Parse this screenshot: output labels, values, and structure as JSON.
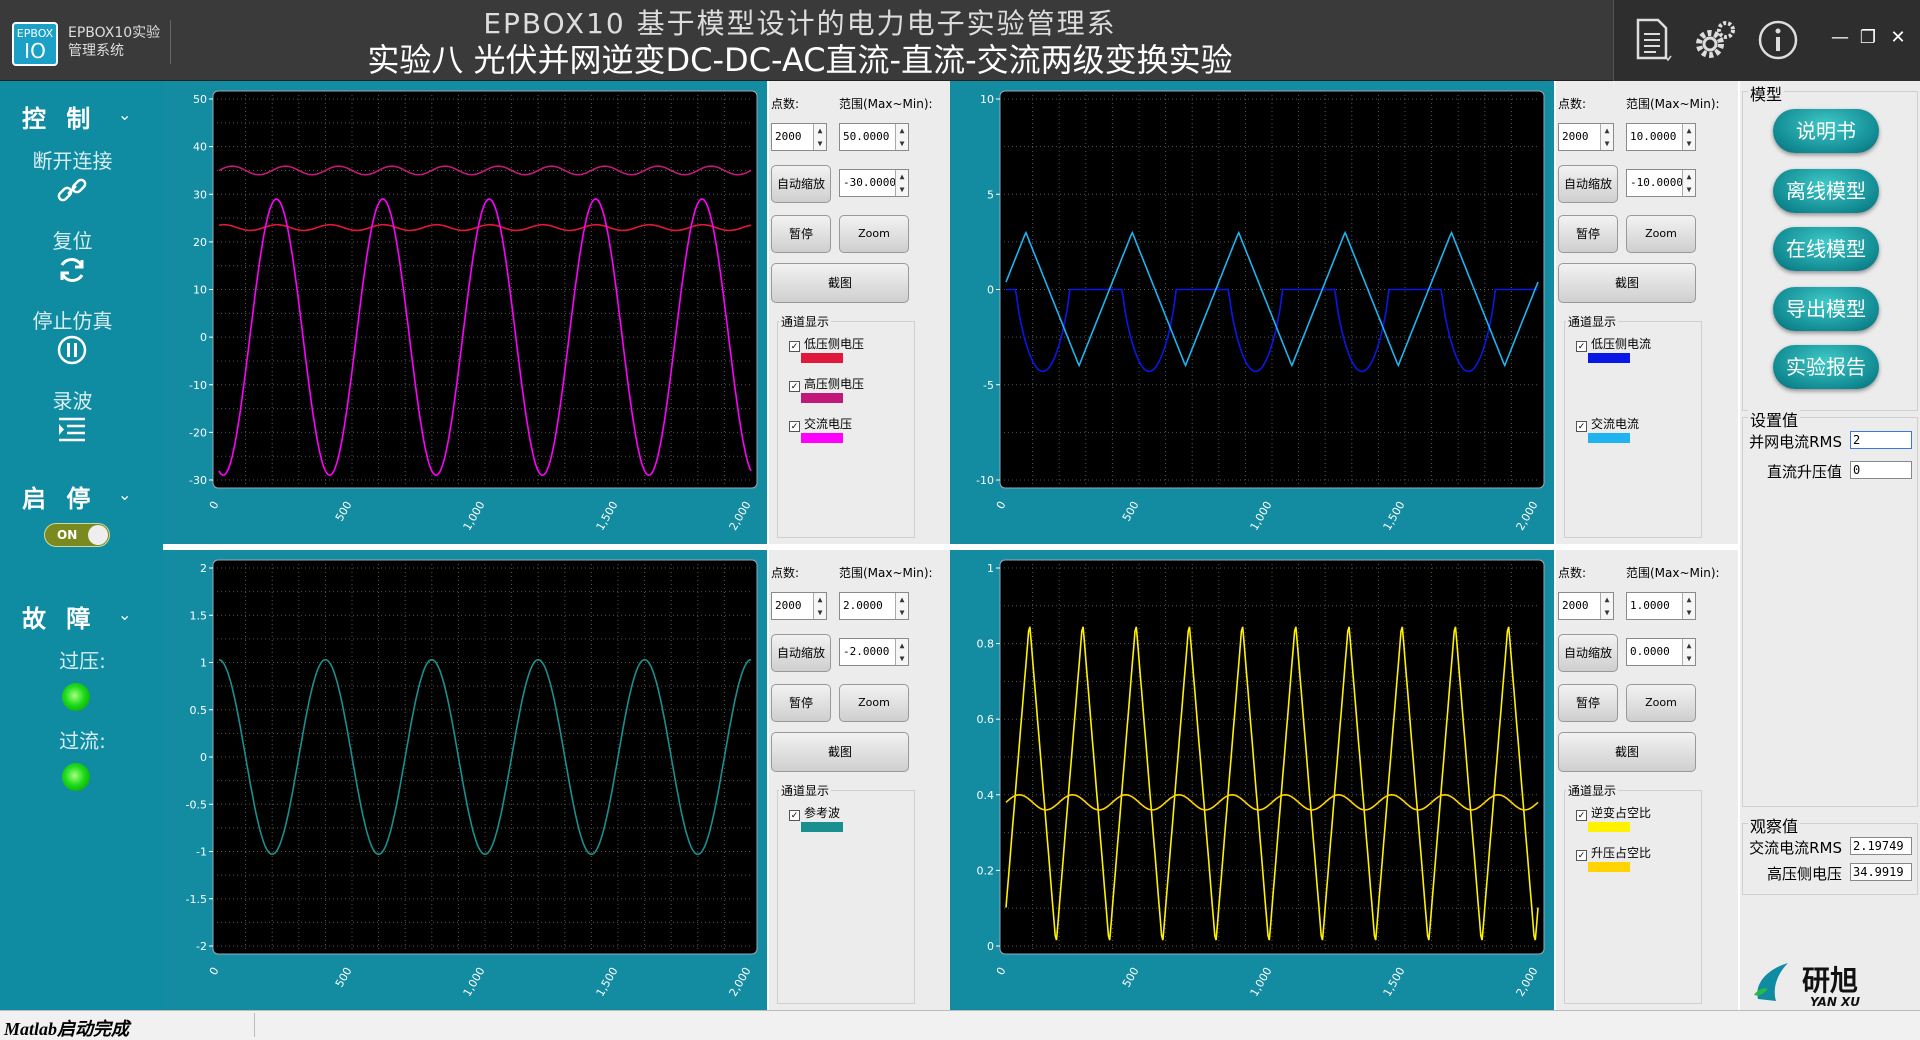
{
  "app": {
    "logo_top": "EPBOX",
    "logo_bottom": "IO",
    "name": "EPBOX10实验管理系统",
    "title_line1": "EPBOX10 基于模型设计的电力电子实验管理系",
    "title_line2": "实验八 光伏并网逆变DC-DC-AC直流-直流-交流两级变换实验"
  },
  "icons": [
    "document-icon",
    "gear-icon",
    "info-icon",
    "minimize-icon",
    "restore-icon",
    "close-icon"
  ],
  "sidebar": {
    "control": {
      "label": "控 制",
      "items": [
        "断开连接",
        "复位",
        "停止仿真",
        "录波"
      ]
    },
    "startstop": {
      "label": "启 停",
      "toggle": "ON"
    },
    "fault": {
      "label": "故 障",
      "items": [
        "过压:",
        "过流:"
      ]
    }
  },
  "plots": [
    {
      "points_label": "点数:",
      "range_label": "范围(Max~Min):",
      "points": "2000",
      "max": "50.0000",
      "min": "-30.0000",
      "autoscale": "自动缩放",
      "pause": "暂停",
      "zoom": "Zoom",
      "screenshot": "截图",
      "channel_title": "通道显示",
      "channels": [
        {
          "name": "低压侧电压",
          "color": "#e0193c"
        },
        {
          "name": "高压侧电压",
          "color": "#c2187a"
        },
        {
          "name": "交流电压",
          "color": "#ff00ff"
        }
      ],
      "yticks": [
        "50",
        "40",
        "30",
        "20",
        "10",
        "0",
        "-10",
        "-20",
        "-30"
      ],
      "xticks": [
        "0",
        "500",
        "1,000",
        "1,500",
        "2,000"
      ]
    },
    {
      "points_label": "点数:",
      "range_label": "范围(Max~Min):",
      "points": "2000",
      "max": "10.0000",
      "min": "-10.0000",
      "autoscale": "自动缩放",
      "pause": "暂停",
      "zoom": "Zoom",
      "screenshot": "截图",
      "channel_title": "通道显示",
      "channels": [
        {
          "name": "低压侧电流",
          "color": "#0a18e6"
        },
        {
          "name": "交流电流",
          "color": "#1fb4f0"
        }
      ],
      "yticks": [
        "10",
        "5",
        "0",
        "-5",
        "-10"
      ],
      "xticks": [
        "0",
        "500",
        "1,000",
        "1,500",
        "2,000"
      ]
    },
    {
      "points_label": "点数:",
      "range_label": "范围(Max~Min):",
      "points": "2000",
      "max": "2.0000",
      "min": "-2.0000",
      "autoscale": "自动缩放",
      "pause": "暂停",
      "zoom": "Zoom",
      "screenshot": "截图",
      "channel_title": "通道显示",
      "channels": [
        {
          "name": "参考波",
          "color": "#1a8f8f"
        }
      ],
      "yticks": [
        "2",
        "1.5",
        "1",
        "0.5",
        "0",
        "-0.5",
        "-1",
        "-1.5",
        "-2"
      ],
      "xticks": [
        "0",
        "500",
        "1,000",
        "1,500",
        "2,000"
      ]
    },
    {
      "points_label": "点数:",
      "range_label": "范围(Max~Min):",
      "points": "2000",
      "max": "1.0000",
      "min": "0.0000",
      "autoscale": "自动缩放",
      "pause": "暂停",
      "zoom": "Zoom",
      "screenshot": "截图",
      "channel_title": "通道显示",
      "channels": [
        {
          "name": "逆变占空比",
          "color": "#fff200"
        },
        {
          "name": "升压占空比",
          "color": "#ffd400"
        }
      ],
      "yticks": [
        "1",
        "0.8",
        "0.6",
        "0.4",
        "0.2",
        "0"
      ],
      "xticks": [
        "0",
        "500",
        "1,000",
        "1,500",
        "2,000"
      ]
    }
  ],
  "chart_data": [
    {
      "type": "line",
      "xlim": [
        0,
        2000
      ],
      "ylim": [
        -30,
        50
      ],
      "series": [
        {
          "name": "低压侧电压",
          "approx_mean": 23,
          "ripple": 1
        },
        {
          "name": "高压侧电压",
          "approx_mean": 35,
          "ripple": 1
        },
        {
          "name": "交流电压",
          "amplitude": 29,
          "cycles": 5
        }
      ]
    },
    {
      "type": "line",
      "xlim": [
        0,
        2000
      ],
      "ylim": [
        -10,
        10
      ],
      "series": [
        {
          "name": "低压侧电流",
          "min": -4.5,
          "max": 0,
          "cycles": 5
        },
        {
          "name": "交流电流",
          "amplitude": 3.5,
          "offset": -0.5,
          "cycles": 5
        }
      ]
    },
    {
      "type": "line",
      "xlim": [
        0,
        2000
      ],
      "ylim": [
        -2,
        2
      ],
      "series": [
        {
          "name": "参考波",
          "amplitude": 1.03,
          "cycles": 5
        }
      ]
    },
    {
      "type": "line",
      "xlim": [
        0,
        2000
      ],
      "ylim": [
        0,
        1
      ],
      "series": [
        {
          "name": "逆变占空比",
          "min": 0,
          "max": 0.86,
          "cycles": 10
        },
        {
          "name": "升压占空比",
          "approx_mean": 0.38,
          "ripple": 0.02
        }
      ]
    }
  ],
  "right": {
    "model_title": "模型",
    "buttons": [
      "说明书",
      "离线模型",
      "在线模型",
      "导出模型",
      "实验报告"
    ],
    "settings_title": "设置值",
    "settings": [
      {
        "label": "并网电流RMS",
        "value": "2"
      },
      {
        "label": "直流升压值",
        "value": "0"
      }
    ],
    "observe_title": "观察值",
    "observe": [
      {
        "label": "交流电流RMS",
        "value": "2.19749"
      },
      {
        "label": "高压侧电压",
        "value": "34.9919"
      }
    ],
    "brand_cn": "研旭",
    "brand_en": "YAN XU"
  },
  "status": "Matlab启动完成"
}
